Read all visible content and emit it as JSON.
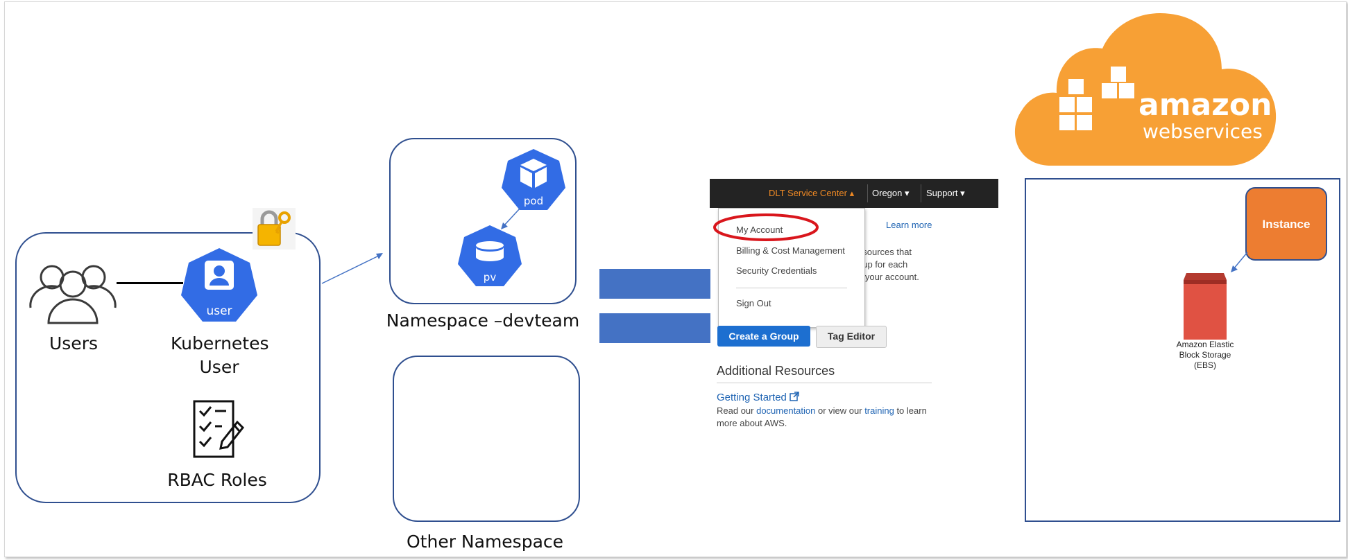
{
  "left_group": {
    "users_label": "Users",
    "k8s_user_label_line1": "Kubernetes",
    "k8s_user_label_line2": "User",
    "k8s_user_icon_text": "user",
    "rbac_label": "RBAC Roles"
  },
  "namespace_devteam": {
    "pod_icon_text": "pod",
    "pv_icon_text": "pv",
    "label": "Namespace –devteam"
  },
  "other_namespace": {
    "label": "Other Namespace"
  },
  "aws_console": {
    "topbar": {
      "account": "DLT Service Center",
      "region": "Oregon",
      "support": "Support"
    },
    "menu_items": [
      "My Account",
      "Billing & Cost Management",
      "Security Credentials",
      "Sign Out"
    ],
    "learn_more": "Learn more",
    "partial_lines": [
      "esources that",
      "oup for each",
      "n your account."
    ],
    "create_group_button": "Create a Group",
    "tag_editor_button": "Tag Editor",
    "additional_resources_title": "Additional Resources",
    "getting_started": "Getting Started",
    "read_line_prefix": "Read our ",
    "documentation": "documentation",
    "read_line_mid": " or view our ",
    "training": "training",
    "read_line_suffix": " to learn",
    "read_line2": "more about AWS."
  },
  "aws_logo": {
    "line1": "amazon",
    "line2": "webservices"
  },
  "aws_box": {
    "instance_label": "Instance",
    "ebs_label_line1": "Amazon Elastic",
    "ebs_label_line2": "Block Storage",
    "ebs_label_line3": "(EBS)"
  },
  "colors": {
    "k8s_blue": "#326ce5",
    "box_border": "#2f4f8f",
    "equals_blue": "#4472c4",
    "aws_orange": "#f7a035",
    "instance_orange": "#ed7d31",
    "ebs_red": "#e05243"
  }
}
